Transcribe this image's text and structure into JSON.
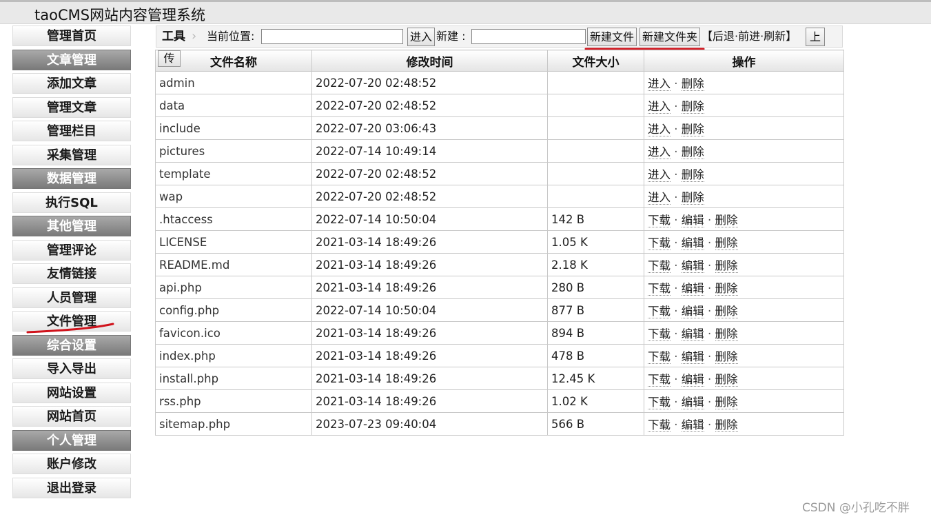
{
  "app": {
    "title": "taoCMS网站内容管理系统"
  },
  "sidebar": {
    "items": [
      {
        "label": "管理首页",
        "group": false
      },
      {
        "label": "文章管理",
        "group": true
      },
      {
        "label": "添加文章",
        "group": false
      },
      {
        "label": "管理文章",
        "group": false
      },
      {
        "label": "管理栏目",
        "group": false
      },
      {
        "label": "采集管理",
        "group": false
      },
      {
        "label": "数据管理",
        "group": true
      },
      {
        "label": "执行SQL",
        "group": false
      },
      {
        "label": "其他管理",
        "group": true
      },
      {
        "label": "管理评论",
        "group": false
      },
      {
        "label": "友情链接",
        "group": false
      },
      {
        "label": "人员管理",
        "group": false
      },
      {
        "label": "文件管理",
        "group": false
      },
      {
        "label": "综合设置",
        "group": true
      },
      {
        "label": "导入导出",
        "group": false
      },
      {
        "label": "网站设置",
        "group": false
      },
      {
        "label": "网站首页",
        "group": false
      },
      {
        "label": "个人管理",
        "group": true
      },
      {
        "label": "账户修改",
        "group": false
      },
      {
        "label": "退出登录",
        "group": false
      }
    ]
  },
  "toolbar": {
    "tools_label": "工具",
    "location_label": "当前位置:",
    "path_value": "",
    "enter_button": "进入",
    "new_label": "新建 :",
    "new_value": "",
    "new_file_button": "新建文件",
    "new_folder_button": "新建文件夹",
    "nav_text": "【后退·前进·刷新】",
    "upload_button": "上"
  },
  "table": {
    "upload_button": "传",
    "headers": {
      "name": "文件名称",
      "mtime": "修改时间",
      "size": "文件大小",
      "ops": "操作"
    },
    "rows": [
      {
        "name": "admin",
        "mtime": "2022-07-20 02:48:52",
        "size": "",
        "ops": [
          "进入",
          "删除"
        ]
      },
      {
        "name": "data",
        "mtime": "2022-07-20 02:48:52",
        "size": "",
        "ops": [
          "进入",
          "删除"
        ]
      },
      {
        "name": "include",
        "mtime": "2022-07-20 03:06:43",
        "size": "",
        "ops": [
          "进入",
          "删除"
        ]
      },
      {
        "name": "pictures",
        "mtime": "2022-07-14 10:49:14",
        "size": "",
        "ops": [
          "进入",
          "删除"
        ]
      },
      {
        "name": "template",
        "mtime": "2022-07-20 02:48:52",
        "size": "",
        "ops": [
          "进入",
          "删除"
        ]
      },
      {
        "name": "wap",
        "mtime": "2022-07-20 02:48:52",
        "size": "",
        "ops": [
          "进入",
          "删除"
        ]
      },
      {
        "name": ".htaccess",
        "mtime": "2022-07-14 10:50:04",
        "size": "142 B",
        "ops": [
          "下载",
          "编辑",
          "删除"
        ]
      },
      {
        "name": "LICENSE",
        "mtime": "2021-03-14 18:49:26",
        "size": "1.05 K",
        "ops": [
          "下载",
          "编辑",
          "删除"
        ]
      },
      {
        "name": "README.md",
        "mtime": "2021-03-14 18:49:26",
        "size": "2.18 K",
        "ops": [
          "下载",
          "编辑",
          "删除"
        ]
      },
      {
        "name": "api.php",
        "mtime": "2021-03-14 18:49:26",
        "size": "280 B",
        "ops": [
          "下载",
          "编辑",
          "删除"
        ]
      },
      {
        "name": "config.php",
        "mtime": "2022-07-14 10:50:04",
        "size": "877 B",
        "ops": [
          "下载",
          "编辑",
          "删除"
        ]
      },
      {
        "name": "favicon.ico",
        "mtime": "2021-03-14 18:49:26",
        "size": "894 B",
        "ops": [
          "下载",
          "编辑",
          "删除"
        ]
      },
      {
        "name": "index.php",
        "mtime": "2021-03-14 18:49:26",
        "size": "478 B",
        "ops": [
          "下载",
          "编辑",
          "删除"
        ]
      },
      {
        "name": "install.php",
        "mtime": "2021-03-14 18:49:26",
        "size": "12.45 K",
        "ops": [
          "下载",
          "编辑",
          "删除"
        ]
      },
      {
        "name": "rss.php",
        "mtime": "2021-03-14 18:49:26",
        "size": "1.02 K",
        "ops": [
          "下载",
          "编辑",
          "删除"
        ]
      },
      {
        "name": "sitemap.php",
        "mtime": "2023-07-23 09:40:04",
        "size": "566 B",
        "ops": [
          "下载",
          "编辑",
          "删除"
        ]
      }
    ]
  },
  "watermark": "CSDN @小孔吃不胖",
  "colors": {
    "annotation_red": "#d0121b",
    "group_gray": "#8a8a8a"
  }
}
